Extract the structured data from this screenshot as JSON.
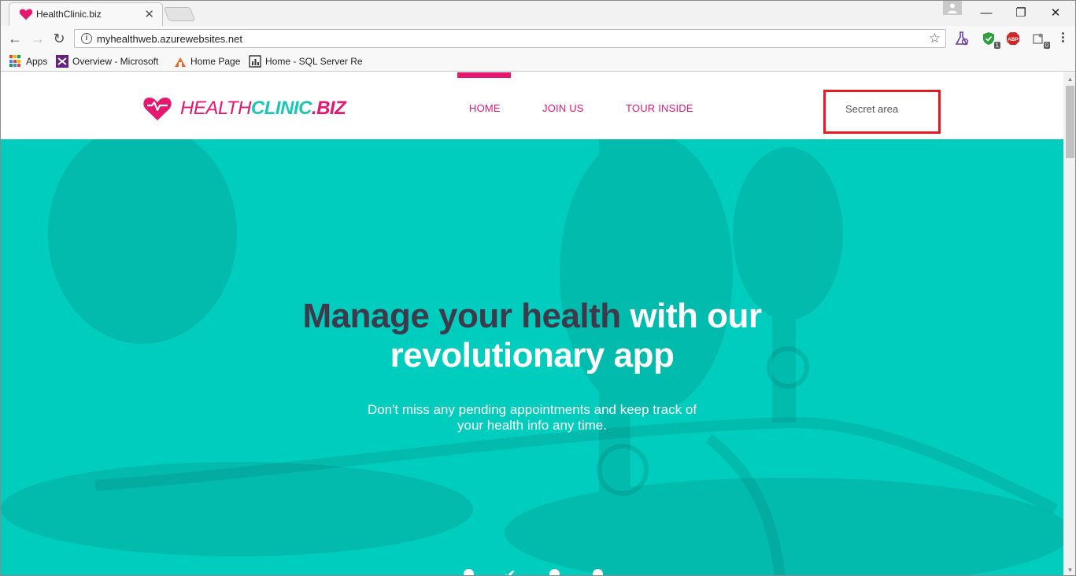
{
  "browser": {
    "tab_title": "HealthClinic.biz",
    "tab_close": "✕",
    "url": "myhealthweb.azurewebsites.net",
    "window_controls": {
      "minimize": "—",
      "maximize": "❐",
      "close": "✕"
    },
    "extensions": [
      {
        "icon": "flask-icon"
      },
      {
        "icon": "shield-icon",
        "badge": "1"
      },
      {
        "icon": "adblock-icon",
        "label": "ABP"
      },
      {
        "icon": "extension-icon",
        "badge": "0"
      }
    ],
    "bookmarks": [
      {
        "label": "Apps",
        "icon": "apps-grid-icon"
      },
      {
        "label": "Overview - Microsoft",
        "icon": "visual-studio-icon"
      },
      {
        "label": "Home Page",
        "icon": "home-page-icon"
      },
      {
        "label": "Home - SQL Server Re",
        "icon": "sql-report-icon"
      }
    ]
  },
  "site": {
    "logo": {
      "part1": "HEALTH",
      "part2": "CLINIC",
      "part3": ".BIZ"
    },
    "nav": [
      {
        "label": "HOME",
        "active": true
      },
      {
        "label": "JOIN US"
      },
      {
        "label": "TOUR INSIDE"
      }
    ],
    "secret_area": "Secret area",
    "hero": {
      "title_dark": "Manage your health",
      "title_light_1": "with our",
      "title_light_2": "revolutionary app",
      "subtitle_line1": "Don't miss any pending appointments and keep track of",
      "subtitle_line2": "your health info any time."
    },
    "colors": {
      "brand_pink": "#e6176f",
      "brand_teal": "#1cc6b4",
      "hero_bg": "#00cdbd",
      "highlight_red": "#e31b23"
    }
  }
}
